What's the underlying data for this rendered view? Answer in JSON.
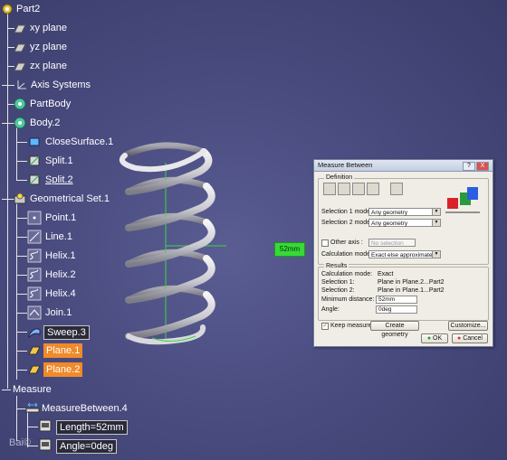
{
  "tree": {
    "items": [
      {
        "label": "Part2"
      },
      {
        "label": "xy plane"
      },
      {
        "label": "yz plane"
      },
      {
        "label": "zx plane"
      },
      {
        "label": "Axis Systems"
      },
      {
        "label": "PartBody"
      },
      {
        "label": "Body.2"
      },
      {
        "label": "CloseSurface.1"
      },
      {
        "label": "Split.1"
      },
      {
        "label": "Split.2"
      },
      {
        "label": "Geometrical Set.1"
      },
      {
        "label": "Point.1"
      },
      {
        "label": "Line.1"
      },
      {
        "label": "Helix.1"
      },
      {
        "label": "Helix.2"
      },
      {
        "label": "Helix.4"
      },
      {
        "label": "Join.1"
      },
      {
        "label": "Sweep.3"
      },
      {
        "label": "Plane.1"
      },
      {
        "label": "Plane.2"
      },
      {
        "label": "Measure"
      },
      {
        "label": "MeasureBetween.4"
      },
      {
        "label": "Length=52mm"
      },
      {
        "label": "Angle=0deg"
      }
    ]
  },
  "viewport": {
    "measure_tag": "52mm",
    "watermark": "Bai©"
  },
  "dialog": {
    "title": "Measure Between",
    "help_btn": "?",
    "close_btn": "X",
    "definition_title": "Definition",
    "selection1_label": "Selection 1 mode:",
    "selection1_value": "Any geometry",
    "selection2_label": "Selection 2 mode:",
    "selection2_value": "Any geometry",
    "other_axis_label": "Other axis :",
    "other_axis_value": "No selection",
    "calc_mode_label": "Calculation mode:",
    "calc_mode_value": "Exact else approximate",
    "results_title": "Results",
    "results": [
      {
        "label": "Calculation mode:",
        "value": "Exact"
      },
      {
        "label": "Selection 1:",
        "value": "Plane in Plane.2...Part2"
      },
      {
        "label": "Selection 2:",
        "value": "Plane in Plane.1...Part2"
      }
    ],
    "min_distance_label": "Minimum distance:",
    "min_distance_value": "52mm",
    "angle_label": "Angle:",
    "angle_value": "0deg",
    "keep_measure_label": "Keep measure",
    "keep_measure_checked": true,
    "create_geometry_btn": "Create geometry",
    "customize_btn": "Customize...",
    "ok_btn": "OK",
    "cancel_btn": "Cancel"
  },
  "colors": {
    "background": "#4a4c80",
    "highlight_orange": "#f08a2a",
    "measure_green": "#39d83a"
  }
}
